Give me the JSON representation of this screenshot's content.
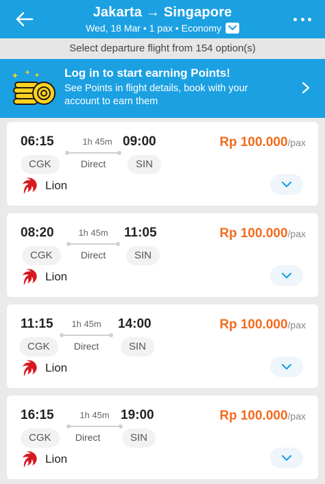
{
  "header": {
    "title": "Jakarta → Singapore",
    "subtitle": "Wed, 18 Mar • 1 pax • Economy",
    "back_icon": "arrow-left-icon",
    "more_icon": "more-dots-icon",
    "color": "#1ba0e2"
  },
  "info_bar": {
    "text": "Select departure flight from 154 option(s)"
  },
  "promo": {
    "title": "Log in to start earning Points!",
    "text": "See Points in flight details, book with your account to earn them",
    "icon": "coins-icon"
  },
  "flights": [
    {
      "depart_time": "06:15",
      "arrive_time": "09:00",
      "duration": "1h 45m",
      "origin": "CGK",
      "destination": "SIN",
      "stops": "Direct",
      "price": "Rp 100.000",
      "per": "/pax",
      "airline": "Lion"
    },
    {
      "depart_time": "08:20",
      "arrive_time": "11:05",
      "duration": "1h 45m",
      "origin": "CGK",
      "destination": "SIN",
      "stops": "Direct",
      "price": "Rp 100.000",
      "per": "/pax",
      "airline": "Lion"
    },
    {
      "depart_time": "11:15",
      "arrive_time": "14:00",
      "duration": "1h 45m",
      "origin": "CGK",
      "destination": "SIN",
      "stops": "Direct",
      "price": "Rp 100.000",
      "per": "/pax",
      "airline": "Lion"
    },
    {
      "depart_time": "16:15",
      "arrive_time": "19:00",
      "duration": "1h 45m",
      "origin": "CGK",
      "destination": "SIN",
      "stops": "Direct",
      "price": "Rp 100.000",
      "per": "/pax",
      "airline": "Lion"
    }
  ],
  "colors": {
    "accent": "#1ba0e2",
    "price": "#f26b1d",
    "airline_logo": "#d71920"
  }
}
